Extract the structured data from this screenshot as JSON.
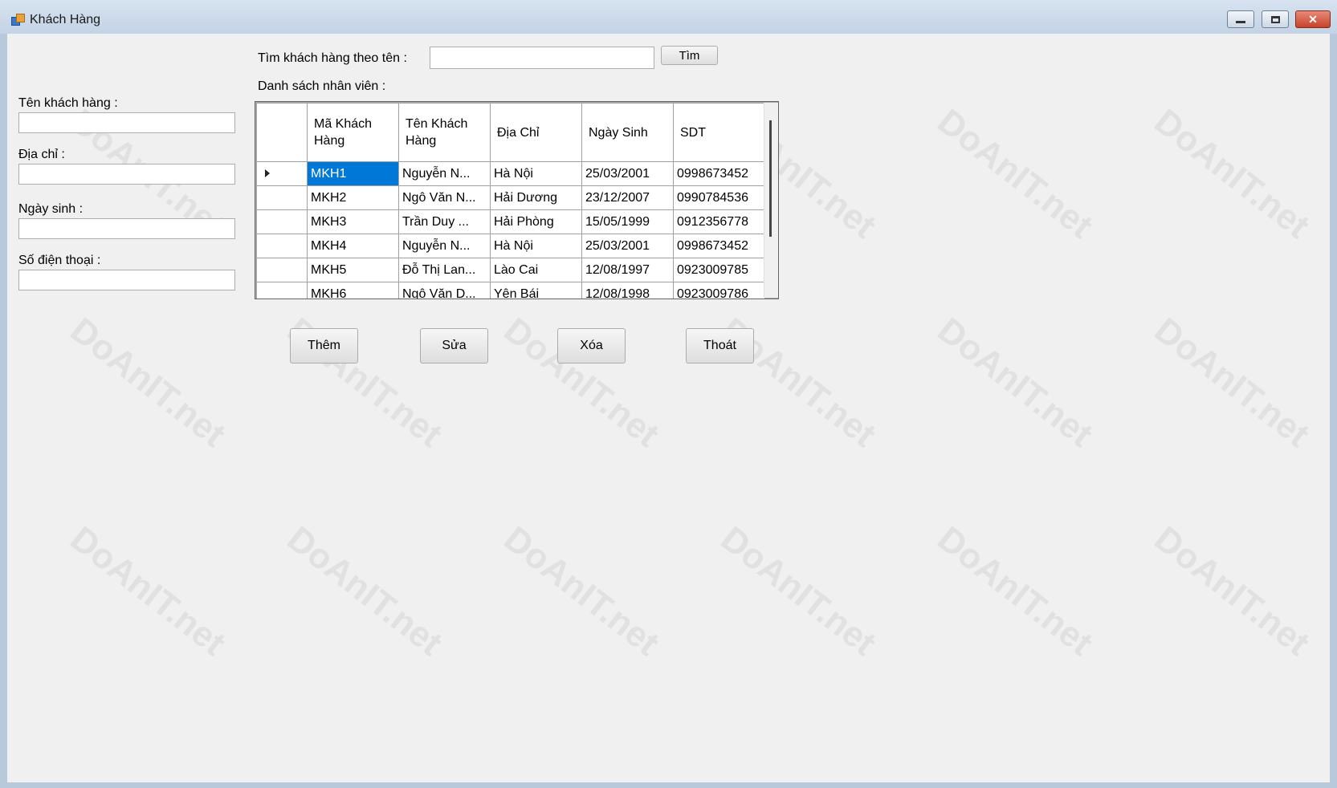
{
  "window": {
    "title": "Khách Hàng",
    "controls": {
      "minimize": "minimize-icon",
      "maximize": "maximize-icon",
      "close": "close-icon",
      "close_glyph": "✕"
    }
  },
  "form": {
    "ten_kh_label": "Tên khách hàng :",
    "ten_kh_value": "",
    "dia_chi_label": "Địa chỉ :",
    "dia_chi_value": "",
    "ngay_sinh_label": "Ngày sinh :",
    "ngay_sinh_value": "",
    "sdt_label": "Số điện thoại :",
    "sdt_value": ""
  },
  "search": {
    "label": "Tìm khách hàng theo tên :",
    "value": "",
    "button": "Tìm"
  },
  "list_label": "Danh sách nhân viên :",
  "grid": {
    "columns": [
      "Mã Khách Hàng",
      "Tên Khách Hàng",
      "Địa Chỉ",
      "Ngày Sinh",
      "SDT"
    ],
    "rows": [
      [
        "MKH1",
        "Nguyễn N...",
        "Hà Nội",
        "25/03/2001",
        "0998673452"
      ],
      [
        "MKH2",
        "Ngô Văn N...",
        "Hải Dương",
        "23/12/2007",
        "0990784536"
      ],
      [
        "MKH3",
        "Trần Duy ...",
        "Hải Phòng",
        "15/05/1999",
        "0912356778"
      ],
      [
        "MKH4",
        "Nguyễn N...",
        "Hà Nội",
        "25/03/2001",
        "0998673452"
      ],
      [
        "MKH5",
        "Đỗ Thị Lan...",
        "Lào Cai",
        "12/08/1997",
        "0923009785"
      ],
      [
        "MKH6",
        "Ngô Văn D...",
        "Yên Bái",
        "12/08/1998",
        "0923009786"
      ]
    ],
    "selected_row": 0
  },
  "buttons": {
    "them": "Thêm",
    "sua": "Sửa",
    "xoa": "Xóa",
    "thoat": "Thoát"
  },
  "watermark": "DoAnIT.net"
}
